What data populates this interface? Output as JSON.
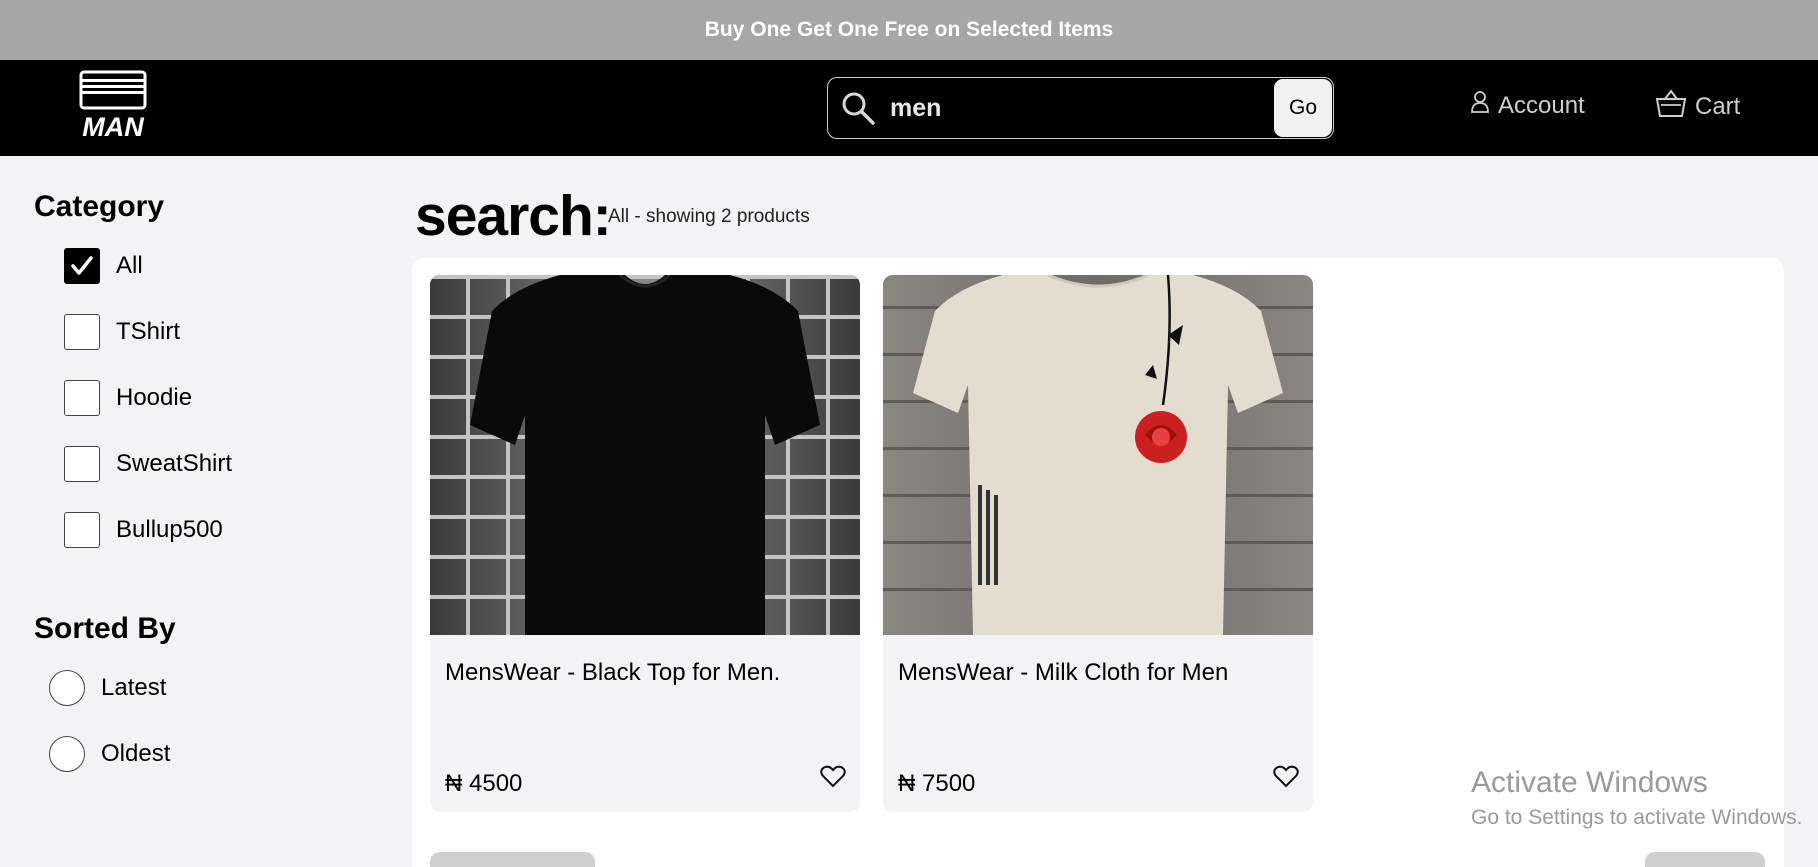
{
  "promo": {
    "text": "Buy One Get One Free on Selected Items"
  },
  "header": {
    "logo_alt": "MAN",
    "search": {
      "value": "men",
      "go_label": "Go"
    },
    "account_label": "Account",
    "cart_label": "Cart"
  },
  "sidebar": {
    "category_title": "Category",
    "categories": [
      {
        "label": "All",
        "checked": true
      },
      {
        "label": "TShirt",
        "checked": false
      },
      {
        "label": "Hoodie",
        "checked": false
      },
      {
        "label": "SweatShirt",
        "checked": false
      },
      {
        "label": "Bullup500",
        "checked": false
      }
    ],
    "sort_title": "Sorted By",
    "sort_options": [
      {
        "label": "Latest",
        "selected": false
      },
      {
        "label": "Oldest",
        "selected": false
      }
    ]
  },
  "results": {
    "title": "search:",
    "subtitle": "All - showing 2 products"
  },
  "products": [
    {
      "name": "MensWear - Black Top for Men.",
      "price": "₦ 4500",
      "color": "#0a0a0a"
    },
    {
      "name": "MensWear - Milk Cloth for Men",
      "price": "₦ 7500",
      "color": "#e3ddd0"
    }
  ],
  "watermark": {
    "title": "Activate Windows",
    "subtitle": "Go to Settings to activate Windows."
  }
}
